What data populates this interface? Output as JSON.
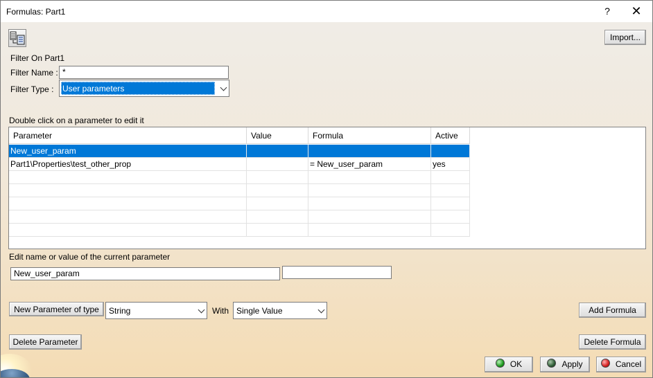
{
  "window": {
    "title": "Formulas: Part1",
    "help_glyph": "?",
    "close_glyph": "✕"
  },
  "toolbar": {
    "import_label": "Import..."
  },
  "filter": {
    "heading": "Filter On Part1",
    "name_label": "Filter Name :",
    "name_value": "*",
    "type_label": "Filter Type :",
    "type_value": "User parameters"
  },
  "table": {
    "instruction": "Double click on a parameter to edit it",
    "columns": [
      "Parameter",
      "Value",
      "Formula",
      "Active"
    ],
    "rows": [
      {
        "parameter": "New_user_param",
        "value": "",
        "formula": "",
        "active": ""
      },
      {
        "parameter": "Part1\\Properties\\test_other_prop",
        "value": "",
        "formula": "= New_user_param",
        "active": "yes"
      },
      {
        "parameter": "",
        "value": "",
        "formula": "",
        "active": ""
      },
      {
        "parameter": "",
        "value": "",
        "formula": "",
        "active": ""
      },
      {
        "parameter": "",
        "value": "",
        "formula": "",
        "active": ""
      },
      {
        "parameter": "",
        "value": "",
        "formula": "",
        "active": ""
      },
      {
        "parameter": "",
        "value": "",
        "formula": "",
        "active": ""
      }
    ],
    "selected_row": 0
  },
  "edit": {
    "label": "Edit name or value of the current parameter",
    "name_value": "New_user_param",
    "value_value": ""
  },
  "new_param": {
    "button_label": "New Parameter of type",
    "type_value": "String",
    "with_label": "With",
    "with_value": "Single Value"
  },
  "actions": {
    "add_formula": "Add Formula",
    "delete_parameter": "Delete Parameter",
    "delete_formula": "Delete Formula",
    "ok": "OK",
    "apply": "Apply",
    "cancel": "Cancel"
  },
  "colors": {
    "selection": "#0078d7",
    "background_bottom": "#f4dcb4"
  },
  "icons": [
    "formula-tool-icon",
    "ok-green-dot-icon",
    "apply-dark-green-dot-icon",
    "cancel-red-dot-icon"
  ]
}
